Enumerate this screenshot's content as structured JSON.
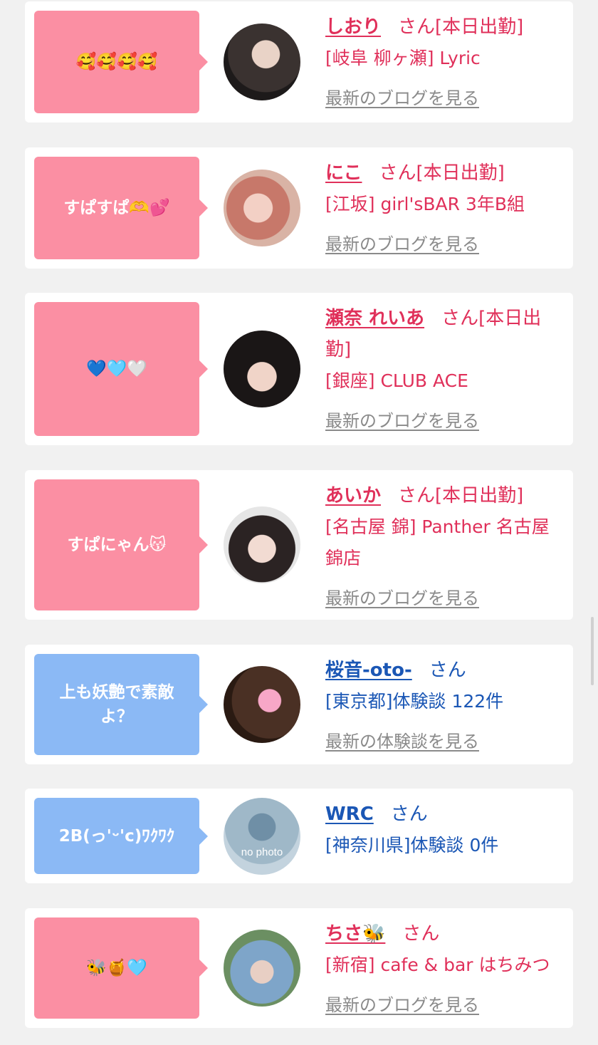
{
  "cards": [
    {
      "comment": "🥰🥰🥰🥰",
      "name": "しおり",
      "suffix": "さん[本日出勤]",
      "info": "[岐阜 柳ヶ瀬] Lyric",
      "link": "最新のブログを見る",
      "avatar_desc": "woman-photo"
    },
    {
      "comment": "すぱすぱ🫶💕",
      "name": "にこ",
      "suffix": "さん[本日出勤]",
      "info": "[江坂] girl'sBAR 3年B組",
      "link": "最新のブログを見る",
      "avatar_desc": "woman-photo"
    },
    {
      "comment": "💙🩵🤍",
      "name": "瀬奈 れいあ",
      "suffix": "さん[本日出勤]",
      "info": "[銀座] CLUB ACE",
      "link": "最新のブログを見る",
      "avatar_desc": "woman-photo"
    },
    {
      "comment": "すぱにゃん😽",
      "name": "あいか",
      "suffix": "さん[本日出勤]",
      "info": "[名古屋 錦] Panther 名古屋錦店",
      "link": "最新のブログを見る",
      "avatar_desc": "woman-photo"
    },
    {
      "comment": "上も妖艶で素敵よ？",
      "name": "桜音-oto-",
      "suffix": "さん",
      "info": "[東京都]体験談 122件",
      "link": "最新の体験談を見る",
      "avatar_desc": "user-photo"
    },
    {
      "comment": "2B(っ'ᵕ'c)ﾜｸﾜｸ",
      "name": "WRC",
      "suffix": "さん",
      "info": "[神奈川県]体験談 0件",
      "link": "",
      "avatar_text": "no photo"
    },
    {
      "comment": "🐝🍯🩵",
      "name": "ちさ🐝",
      "suffix": "さん",
      "info": "[新宿] cafe & bar はちみつ",
      "link": "最新のブログを見る",
      "avatar_desc": "woman-photo"
    }
  ],
  "colors": {
    "pink_bubble": "#fb8fa3",
    "blue_bubble": "#8bb9f5",
    "pink_text": "#e0305a",
    "blue_text": "#1b57b5"
  }
}
